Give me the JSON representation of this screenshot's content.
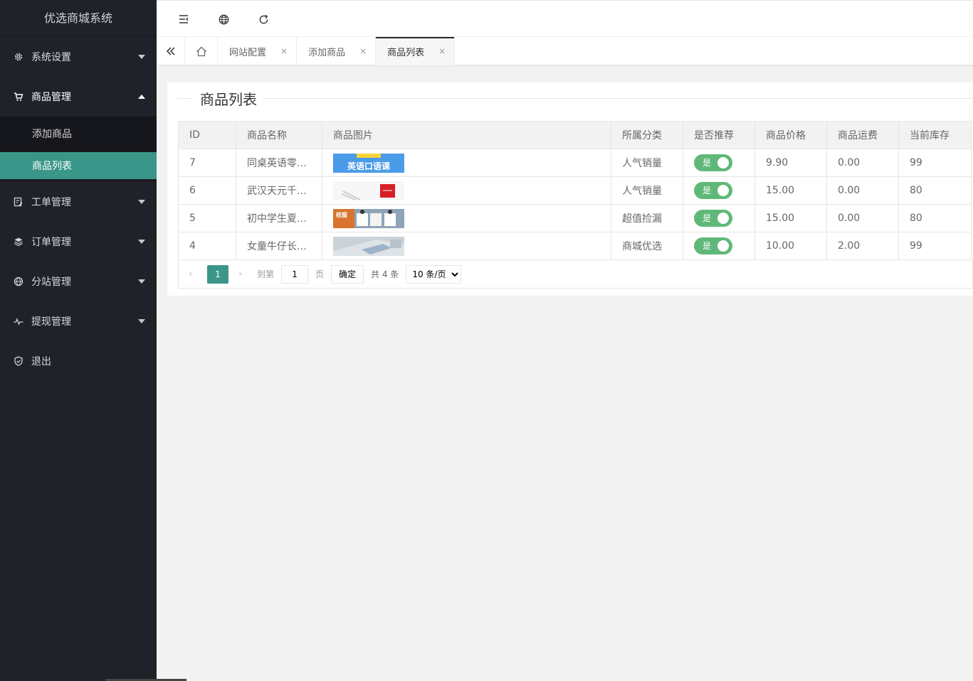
{
  "app": {
    "title": "优选商城系统"
  },
  "sidebar": {
    "menus": [
      {
        "label": "系统设置",
        "icon": "gear-icon",
        "open": false
      },
      {
        "label": "商品管理",
        "icon": "cart-icon",
        "open": true,
        "children": [
          {
            "label": "添加商品",
            "active": false
          },
          {
            "label": "商品列表",
            "active": true
          }
        ]
      },
      {
        "label": "工单管理",
        "icon": "ticket-icon",
        "open": false
      },
      {
        "label": "订单管理",
        "icon": "layers-icon",
        "open": false
      },
      {
        "label": "分站管理",
        "icon": "globe-icon",
        "open": false
      },
      {
        "label": "提现管理",
        "icon": "pulse-icon",
        "open": false
      },
      {
        "label": "退出",
        "icon": "shield-icon",
        "open": false
      }
    ]
  },
  "header": {
    "buttons": [
      "menu-toggle-icon",
      "globe-icon",
      "refresh-icon"
    ]
  },
  "tabs": {
    "items": [
      {
        "label": "网站配置",
        "active": false
      },
      {
        "label": "添加商品",
        "active": false
      },
      {
        "label": "商品列表",
        "active": true
      }
    ],
    "close_glyph": "×"
  },
  "page": {
    "title": "商品列表",
    "columns": [
      "ID",
      "商品名称",
      "商品图片",
      "所属分类",
      "是否推荐",
      "商品价格",
      "商品运费",
      "当前库存"
    ],
    "rows": [
      {
        "id": "7",
        "name": "同桌英语零…",
        "image_text": "英语口语课",
        "category": "人气销量",
        "recommend": "是",
        "price": "9.90",
        "freight": "0.00",
        "stock": "99"
      },
      {
        "id": "6",
        "name": "武汉天元千…",
        "image_text": "",
        "category": "人气销量",
        "recommend": "是",
        "price": "15.00",
        "freight": "0.00",
        "stock": "80"
      },
      {
        "id": "5",
        "name": "初中学生夏…",
        "image_text": "校服",
        "category": "超值捡漏",
        "recommend": "是",
        "price": "15.00",
        "freight": "0.00",
        "stock": "80"
      },
      {
        "id": "4",
        "name": "女童牛仔长…",
        "image_text": "",
        "category": "商城优选",
        "recommend": "是",
        "price": "10.00",
        "freight": "2.00",
        "stock": "99"
      }
    ]
  },
  "pager": {
    "prev": "‹",
    "current": "1",
    "next": "›",
    "goto_label": "到第",
    "goto_value": "1",
    "page_unit": "页",
    "confirm": "确定",
    "total": "共 4 条",
    "page_size": "10 条/页"
  },
  "colors": {
    "accent": "#3a9688",
    "sidebar": "#20222a",
    "link": "#1e9fff",
    "price": "#ff5722",
    "switch_on": "#5fb878"
  }
}
